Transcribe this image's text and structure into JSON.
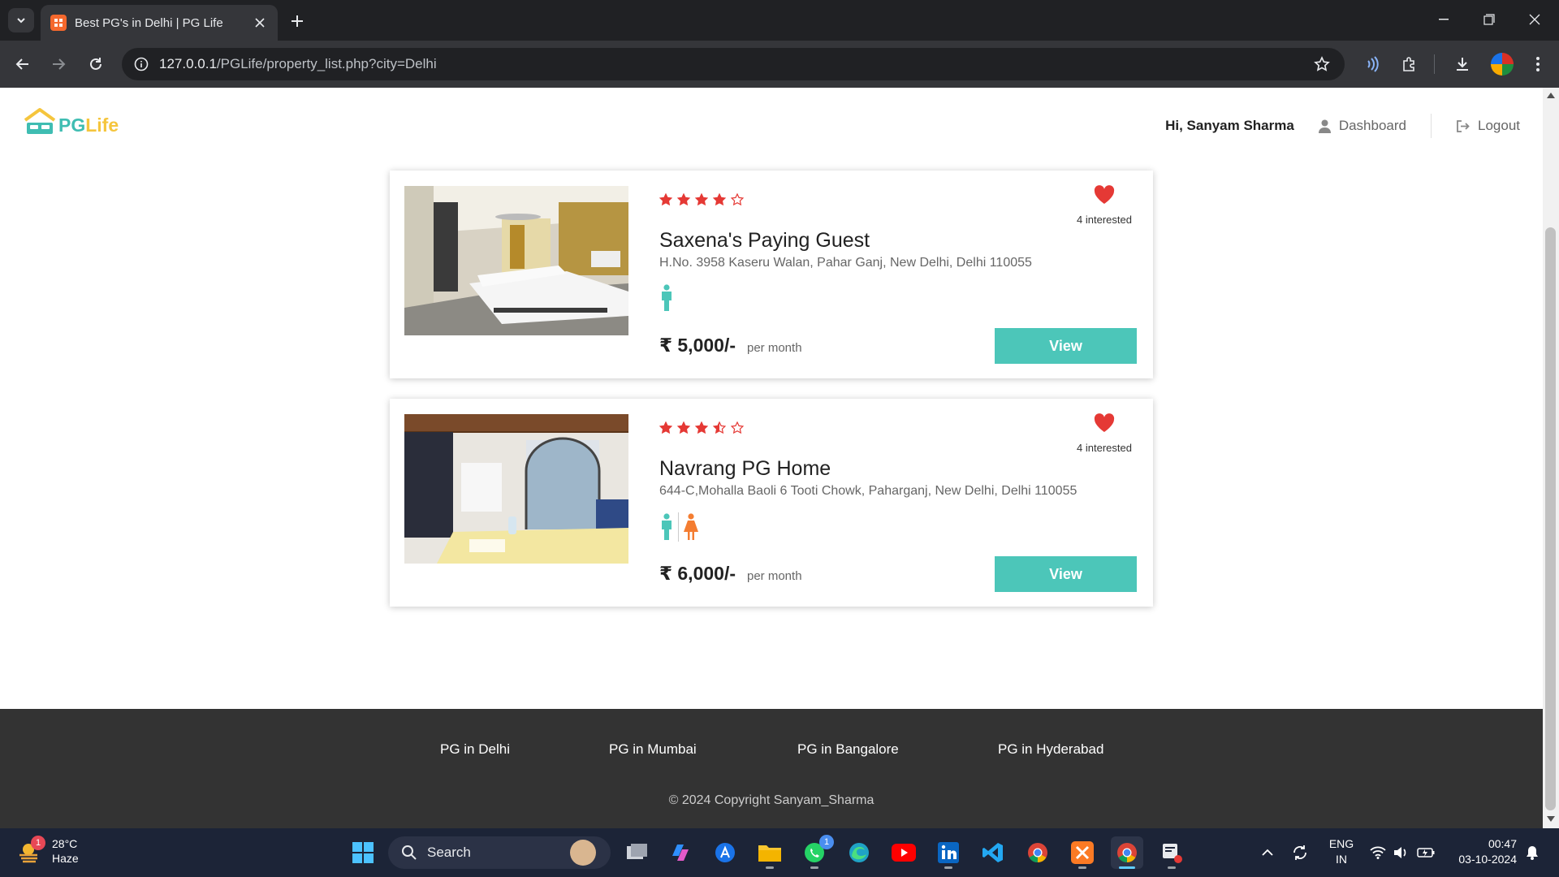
{
  "browser": {
    "tab_title": "Best PG's in Delhi | PG Life",
    "url_host": "127.0.0.1",
    "url_path": "/PGLife/property_list.php?city=Delhi"
  },
  "header": {
    "brand_pg": "PG",
    "brand_life": "Life",
    "greeting": "Hi, Sanyam Sharma",
    "dashboard_label": "Dashboard",
    "logout_label": "Logout"
  },
  "properties": [
    {
      "name": "Saxena's Paying Guest",
      "address": "H.No. 3958 Kaseru Walan, Pahar Ganj, New Delhi, Delhi 110055",
      "rating": 4,
      "interested": "4 interested",
      "rent": "₹ 5,000/-",
      "rent_unit": "per month",
      "gender": "male",
      "view_label": "View"
    },
    {
      "name": "Navrang PG Home",
      "address": "644-C,Mohalla Baoli 6 Tooti Chowk, Paharganj, New Delhi, Delhi 110055",
      "rating": 3.5,
      "interested": "4 interested",
      "rent": "₹ 6,000/-",
      "rent_unit": "per month",
      "gender": "unisex",
      "view_label": "View"
    }
  ],
  "footer": {
    "links": [
      "PG in Delhi",
      "PG in Mumbai",
      "PG in Bangalore",
      "PG in Hyderabad"
    ],
    "copyright": "© 2024 Copyright Sanyam_Sharma"
  },
  "taskbar": {
    "weather_badge": "1",
    "temperature": "28°C",
    "condition": "Haze",
    "search_placeholder": "Search",
    "whatsapp_badge": "1",
    "lang_line1": "ENG",
    "lang_line2": "IN",
    "time": "00:47",
    "date": "03-10-2024"
  },
  "colors": {
    "accent_teal": "#4cc6b9",
    "star_red": "#e53935",
    "female_orange": "#f47d31",
    "footer_bg": "#333333"
  },
  "icons": [
    "tab-search-icon",
    "favicon-icon",
    "close-icon",
    "plus-icon",
    "minimize-icon",
    "maximize-icon",
    "back-icon",
    "forward-icon",
    "reload-icon",
    "info-icon",
    "star-bookmark-icon",
    "read-aloud-icon",
    "extensions-icon",
    "download-icon",
    "more-icon",
    "house-logo-icon",
    "user-icon",
    "logout-icon",
    "star-icon",
    "heart-icon",
    "male-icon",
    "female-icon",
    "windows-icon",
    "search-icon",
    "wifi-icon",
    "speaker-icon",
    "battery-icon",
    "bell-icon"
  ]
}
